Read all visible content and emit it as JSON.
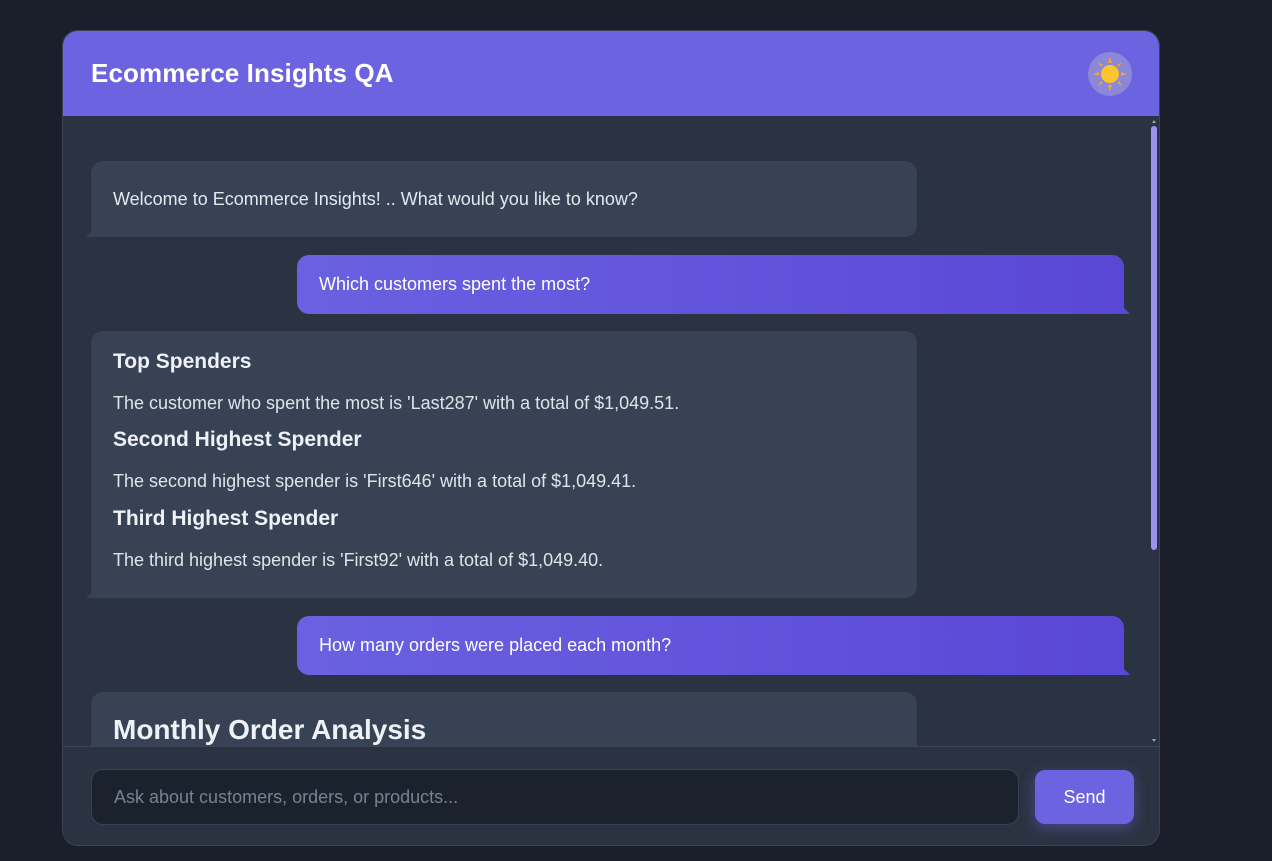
{
  "header": {
    "title": "Ecommerce Insights QA",
    "theme_icon": "sun-icon"
  },
  "messages": [
    {
      "role": "bot",
      "text": "Welcome to Ecommerce Insights! .. What would you like to know?"
    },
    {
      "role": "user",
      "text": "Which customers spent the most?"
    },
    {
      "role": "bot",
      "sections": [
        {
          "heading": "Top Spenders",
          "text": "The customer who spent the most is 'Last287' with a total of $1,049.51."
        },
        {
          "heading": "Second Highest Spender",
          "text": "The second highest spender is 'First646' with a total of $1,049.41."
        },
        {
          "heading": "Third Highest Spender",
          "text": "The third highest spender is 'First92' with a total of $1,049.40."
        }
      ]
    },
    {
      "role": "user",
      "text": "How many orders were placed each month?"
    },
    {
      "role": "bot",
      "heading": "Monthly Order Analysis"
    }
  ],
  "composer": {
    "placeholder": "Ask about customers, orders, or products...",
    "value": "",
    "send_label": "Send"
  },
  "colors": {
    "accent": "#6c63e0",
    "background": "#1a1f2b",
    "panel": "#2b3241",
    "bot_bubble": "#374254"
  }
}
